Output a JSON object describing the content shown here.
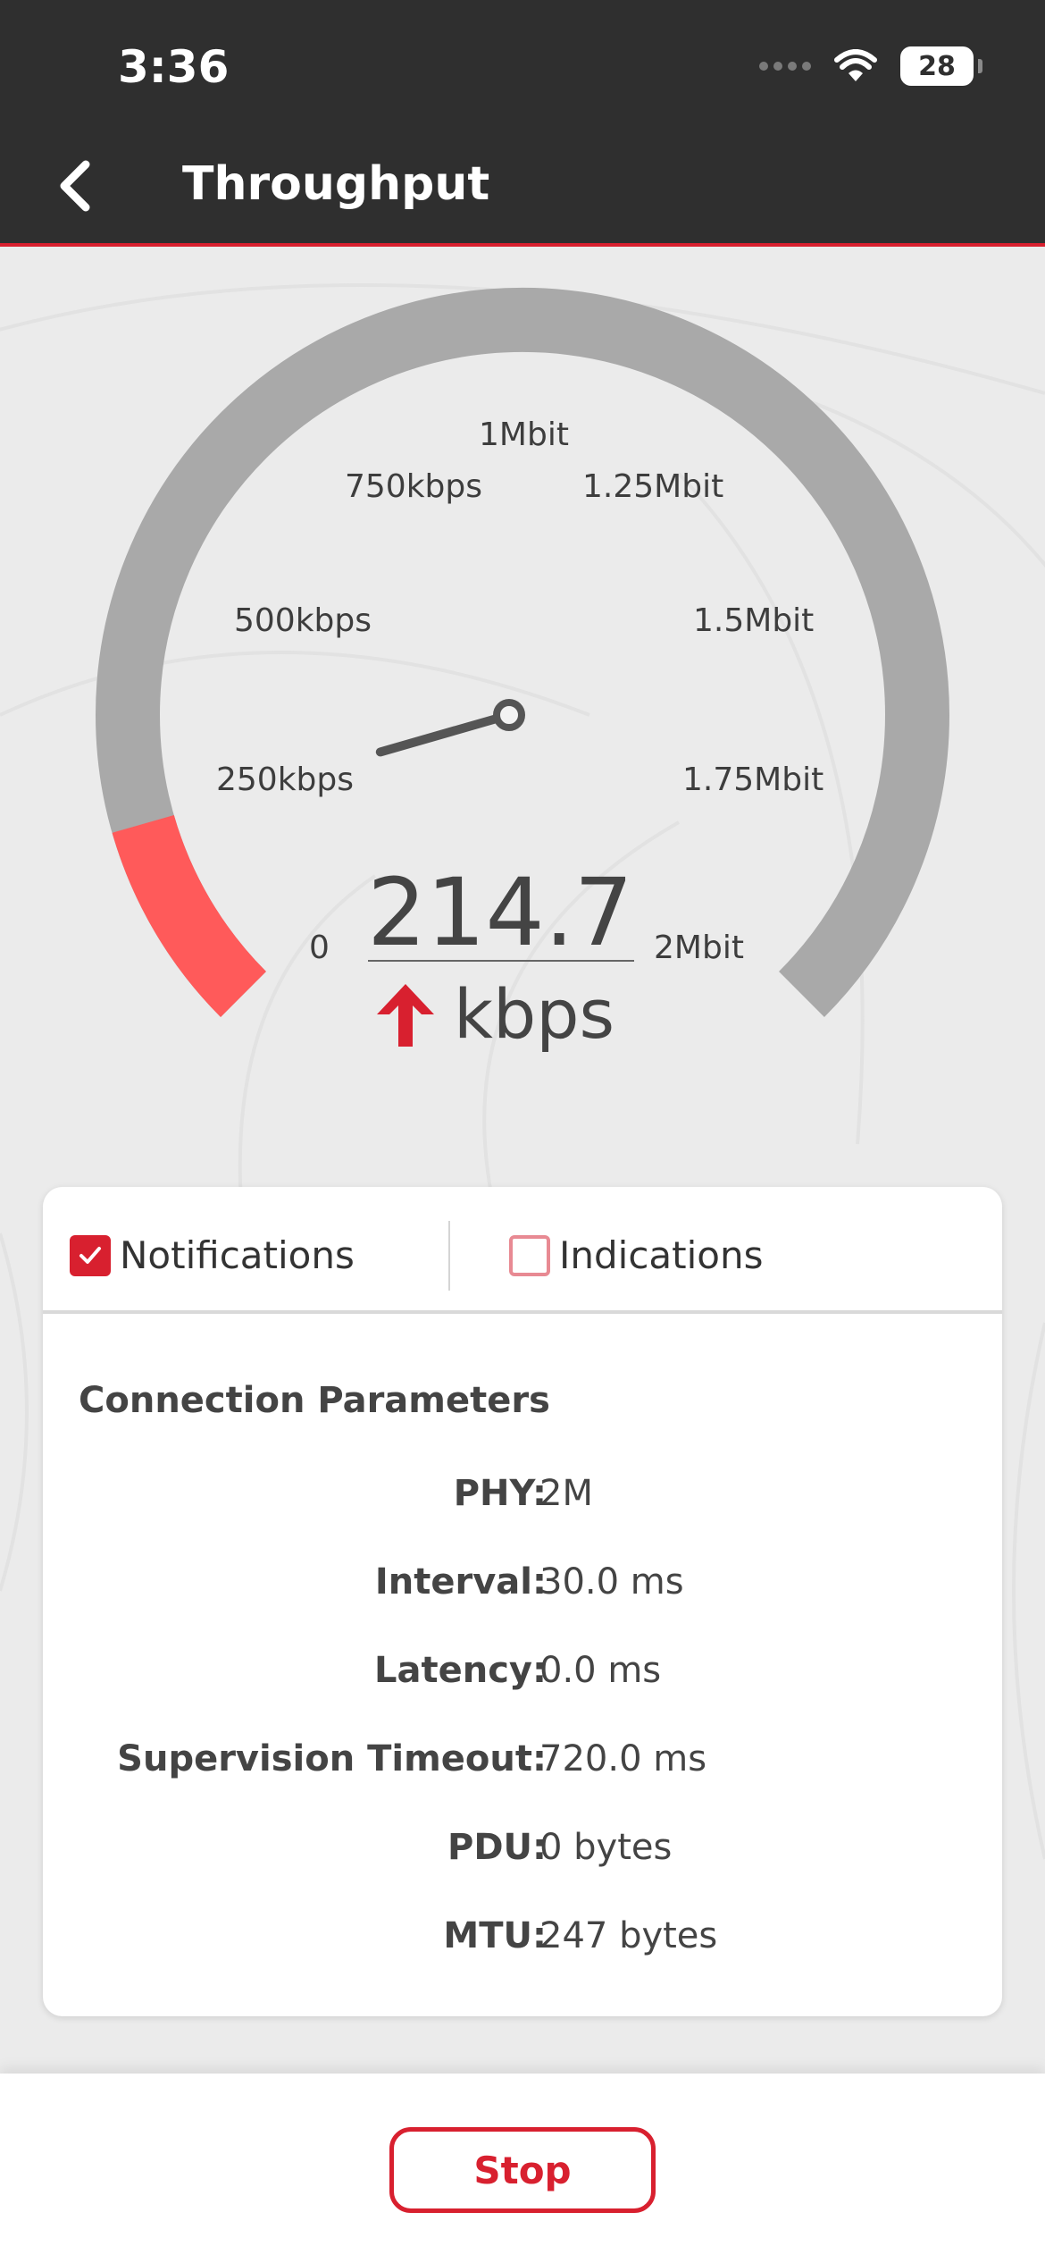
{
  "status_bar": {
    "time": "3:36",
    "battery": "28"
  },
  "header": {
    "title": "Throughput"
  },
  "gauge": {
    "labels": [
      "0",
      "250kbps",
      "500kbps",
      "750kbps",
      "1Mbit",
      "1.25Mbit",
      "1.5Mbit",
      "1.75Mbit",
      "2Mbit"
    ],
    "value": "214.7",
    "unit": "kbps",
    "value_kbps": 214.7,
    "max_kbps": 2000,
    "colors": {
      "track": "#a9a9a9",
      "fill": "#ff5a5a",
      "accent": "#d8202f"
    }
  },
  "tabs": [
    {
      "label": "Notifications",
      "checked": true
    },
    {
      "label": "Indications",
      "checked": false
    }
  ],
  "connection": {
    "title": "Connection Parameters",
    "params": [
      {
        "key": "PHY:",
        "value": "2M"
      },
      {
        "key": "Interval:",
        "value": "30.0 ms"
      },
      {
        "key": "Latency:",
        "value": "0.0 ms"
      },
      {
        "key": "Supervision Timeout:",
        "value": "720.0 ms"
      },
      {
        "key": "PDU:",
        "value": "0 bytes"
      },
      {
        "key": "MTU:",
        "value": "247 bytes"
      }
    ]
  },
  "footer": {
    "stop_label": "Stop"
  }
}
